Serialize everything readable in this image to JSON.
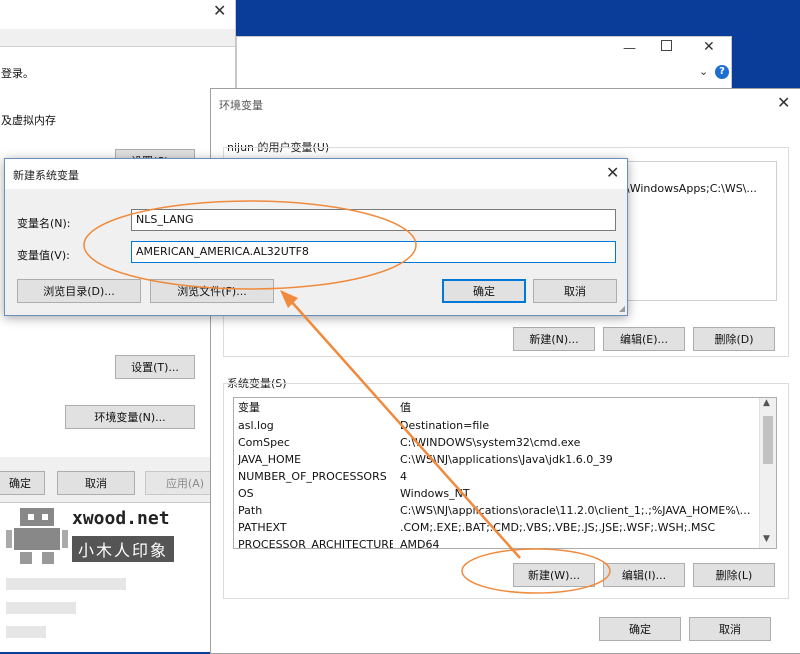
{
  "behind_window": {
    "text_login": "登录。",
    "text_vmem": "及虚拟内存",
    "settings_btn_top": "设置(S)...",
    "settings_btn": "设置(T)...",
    "env_btn": "环境变量(N)...",
    "ok": "确定",
    "cancel": "取消",
    "apply": "应用(A)"
  },
  "env_dialog": {
    "title": "环境变量",
    "user_group": "nijun 的用户变量(U)",
    "user_path_snippet": "\\WindowsApps;C:\\WS\\...",
    "user_buttons": {
      "new": "新建(N)...",
      "edit": "编辑(E)...",
      "delete": "删除(D)"
    },
    "sys_group": "系统变量(S)",
    "sys_header": {
      "var": "变量",
      "val": "值"
    },
    "sys_rows": [
      {
        "var": "asl.log",
        "val": "Destination=file"
      },
      {
        "var": "ComSpec",
        "val": "C:\\WINDOWS\\system32\\cmd.exe"
      },
      {
        "var": "JAVA_HOME",
        "val": "C:\\WS\\NJ\\applications\\Java\\jdk1.6.0_39"
      },
      {
        "var": "NUMBER_OF_PROCESSORS",
        "val": "4"
      },
      {
        "var": "OS",
        "val": "Windows_NT"
      },
      {
        "var": "Path",
        "val": "C:\\WS\\NJ\\applications\\oracle\\11.2.0\\client_1;.;%JAVA_HOME%\\bi..."
      },
      {
        "var": "PATHEXT",
        "val": ".COM;.EXE;.BAT;.CMD;.VBS;.VBE;.JS;.JSE;.WSF;.WSH;.MSC"
      },
      {
        "var": "PROCESSOR_ARCHITECTURE",
        "val": "AMD64"
      }
    ],
    "sys_buttons": {
      "new": "新建(W)...",
      "edit": "编辑(I)...",
      "delete": "删除(L)"
    },
    "ok": "确定",
    "cancel": "取消"
  },
  "new_var_dialog": {
    "title": "新建系统变量",
    "name_label": "变量名(N):",
    "name_value": "NLS_LANG",
    "value_label": "变量值(V):",
    "value_value": "AMERICAN_AMERICA.AL32UTF8",
    "browse_dir": "浏览目录(D)...",
    "browse_file": "浏览文件(F)...",
    "ok": "确定",
    "cancel": "取消"
  },
  "watermark": {
    "brand": "xwood.net",
    "subtitle": "小木人印象"
  },
  "colors": {
    "annotation": "#f08a3c",
    "accent": "#0078d7",
    "desktop": "#0a3d9a"
  }
}
